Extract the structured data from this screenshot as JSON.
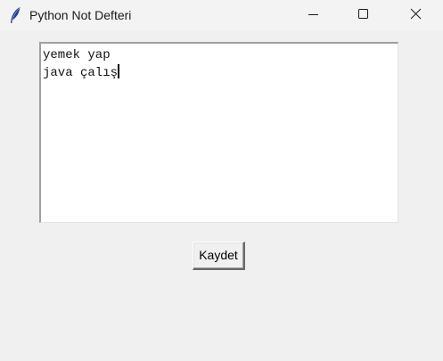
{
  "window": {
    "title": "Python Not Defteri",
    "app_icon": "feather-icon",
    "controls": {
      "minimize_icon": "minimize-icon",
      "maximize_icon": "maximize-icon",
      "close_icon": "close-icon"
    }
  },
  "editor": {
    "lines": [
      "yemek yap",
      "java çalış"
    ]
  },
  "actions": {
    "save_label": "Kaydet"
  },
  "colors": {
    "window_background": "#f0f0f0",
    "titlebar_background": "#f3f3f3",
    "editor_background": "#ffffff",
    "text": "#111111"
  }
}
